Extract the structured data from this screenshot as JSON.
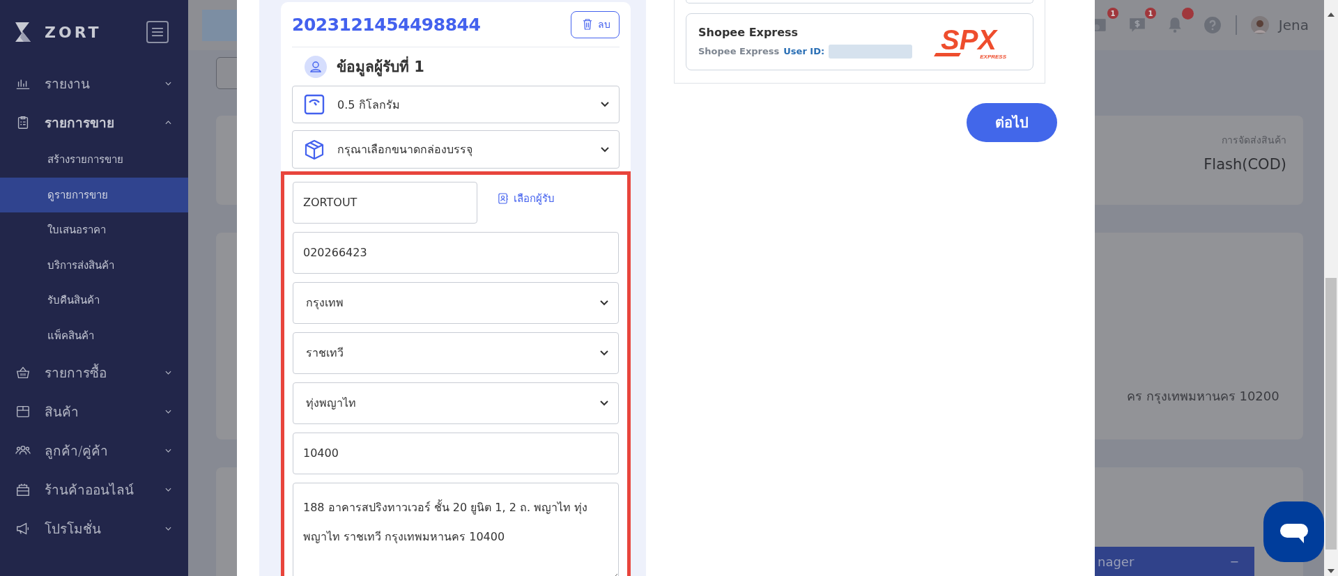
{
  "sidebar": {
    "brand": "ZORT",
    "items": [
      {
        "label": "รายงาน",
        "expanded": false
      },
      {
        "label": "รายการขาย",
        "expanded": true,
        "children": [
          {
            "label": "สร้างรายการขาย",
            "selected": false
          },
          {
            "label": "ดูรายการขาย",
            "selected": true
          },
          {
            "label": "ใบเสนอราคา",
            "selected": false
          },
          {
            "label": "บริการส่งสินค้า",
            "selected": false
          },
          {
            "label": "รับคืนสินค้า",
            "selected": false
          },
          {
            "label": "แพ็คสินค้า",
            "selected": false
          }
        ]
      },
      {
        "label": "รายการซื้อ",
        "expanded": false
      },
      {
        "label": "สินค้า",
        "expanded": false
      },
      {
        "label": "ลูกค้า/คู่ค้า",
        "expanded": false
      },
      {
        "label": "ร้านค้าออนไลน์",
        "expanded": false
      },
      {
        "label": "โปรโมชั่น",
        "expanded": false
      }
    ]
  },
  "top_bar": {
    "icons": [
      {
        "kind": "award",
        "badge": "1"
      },
      {
        "kind": "money",
        "badge": "1"
      },
      {
        "kind": "bell",
        "dot": true
      },
      {
        "kind": "help"
      }
    ],
    "user": "Jena"
  },
  "background": {
    "shipping_label": "การจัดส่งสินค้า",
    "shipping_value": "Flash(COD)",
    "address_fragment": "คร กรุงเทพมหานคร 10200",
    "bottom_bar": {
      "title": "nager",
      "minimize": "−"
    }
  },
  "modal": {
    "order": {
      "number": "2023121454498844",
      "delete": "ลบ",
      "recipient_title": "ข้อมูลผู้รับที่ 1",
      "weight": "0.5 กิโลกรัม",
      "box_size": "กรุณาเลือกขนาดกล่องบรรจุ",
      "form": {
        "highlighted": true,
        "name": "ZORTOUT",
        "pick_recipient": "เลือกผู้รับ",
        "phone": "020266423",
        "province": "กรุงเทพ",
        "district": "ราชเทวี",
        "subdistrict": "ทุ่งพญาไท",
        "postcode": "10400",
        "address": "188 อาคารสปริงทาวเวอร์ ชั้น 20 ยูนิต 1, 2 ถ. พญาไท ทุ่งพญาไท ราชเทวี กรุงเทพมหานคร 10400"
      }
    },
    "carriers": [
      {
        "name": "Shopee Express",
        "subtitle": "Shopee Express",
        "user_id_label": "User ID:",
        "logo": "SPX",
        "logo_sub": "EXPRESS"
      }
    ],
    "next": "ต่อไป"
  }
}
